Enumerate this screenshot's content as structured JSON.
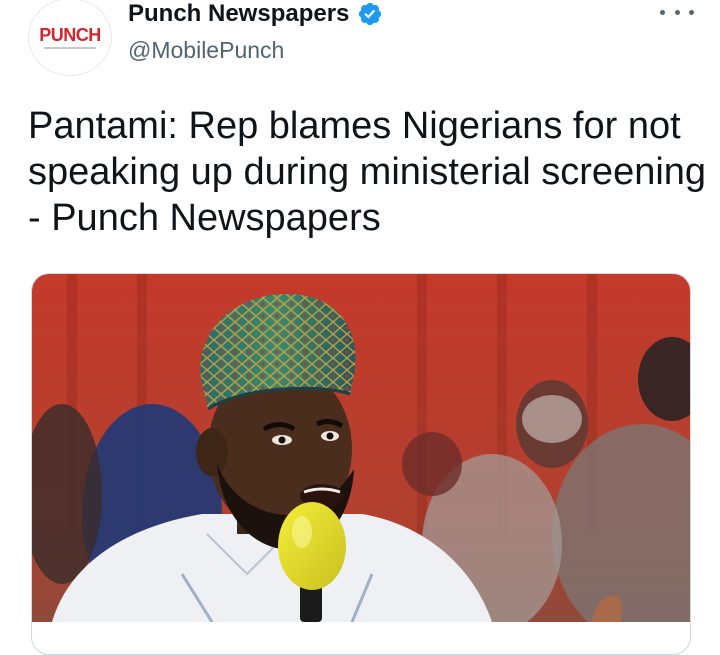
{
  "account": {
    "display_name": "Punch Newspapers",
    "handle": "@MobilePunch",
    "avatar_logo_text": "PUNCH",
    "verified_icon": "verified-badge-icon"
  },
  "tweet": {
    "headline": "Pantami: Rep blames Nigerians for not speaking up during ministerial screening - Punch Newspapers"
  },
  "icons": {
    "more": "more-options-icon"
  },
  "colors": {
    "verified_blue": "#1d9bf0",
    "brand_red": "#d6242a",
    "background_red": "#c8382a"
  }
}
